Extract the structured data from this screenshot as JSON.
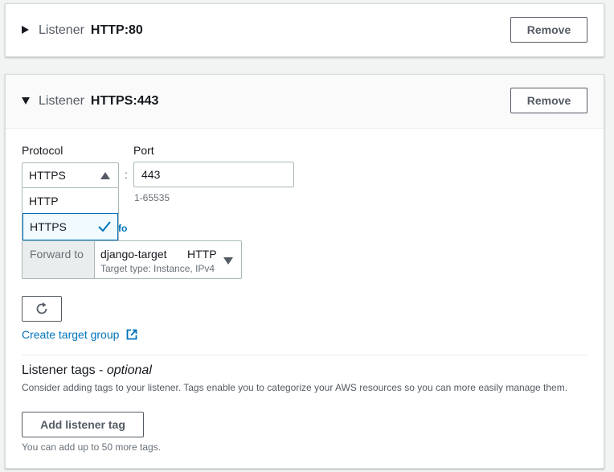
{
  "listener1": {
    "label": "Listener",
    "value": "HTTP:80",
    "remove_label": "Remove"
  },
  "listener2": {
    "label": "Listener",
    "value": "HTTPS:443",
    "remove_label": "Remove"
  },
  "protocol": {
    "label": "Protocol",
    "selected": "HTTPS",
    "options": [
      "HTTP",
      "HTTPS"
    ]
  },
  "port": {
    "label": "Port",
    "separator": ":",
    "value": "443",
    "hint": "1-65535"
  },
  "info_fragment": "fo",
  "forward": {
    "addon_label": "Forward to",
    "target_name": "django-target",
    "target_protocol": "HTTP",
    "target_desc": "Target type: Instance, IPv4"
  },
  "create_target_group_label": "Create target group",
  "tags": {
    "title": "Listener tags - ",
    "title_optional": "optional",
    "description": "Consider adding tags to your listener. Tags enable you to categorize your AWS resources so you can more easily manage them.",
    "add_button_label": "Add listener tag",
    "footer": "You can add up to 50 more tags."
  },
  "icons": {
    "caret_collapsed": "caret-right-icon",
    "caret_expanded": "caret-down-icon",
    "dropdown": "caret-up-icon",
    "check": "check-icon",
    "refresh": "refresh-icon",
    "external": "external-link-icon"
  },
  "colors": {
    "link": "#0073bb",
    "text": "#16191f",
    "secondary_text": "#687078",
    "border": "#aab7b8"
  }
}
